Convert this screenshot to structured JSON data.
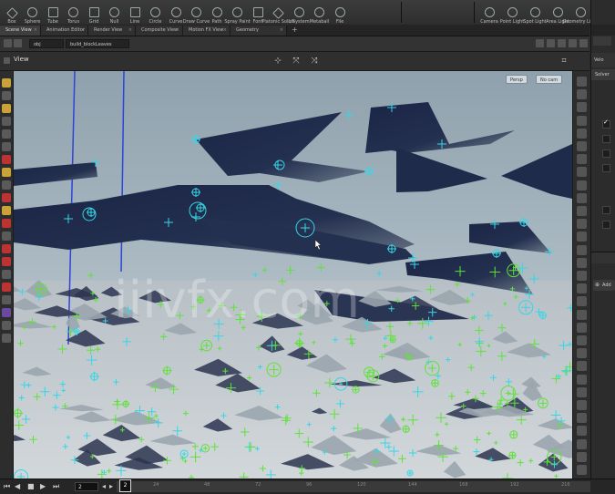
{
  "shelf_tools_left": [
    {
      "label": "Box",
      "icon": "box-icon"
    },
    {
      "label": "Sphere",
      "icon": "sphere-icon"
    },
    {
      "label": "Tube",
      "icon": "tube-icon"
    },
    {
      "label": "Torus",
      "icon": "torus-icon"
    },
    {
      "label": "Grid",
      "icon": "grid-icon"
    },
    {
      "label": "Null",
      "icon": "null-icon"
    },
    {
      "label": "Line",
      "icon": "line-icon"
    },
    {
      "label": "Circle",
      "icon": "circle-icon"
    },
    {
      "label": "Curve",
      "icon": "curve-icon"
    },
    {
      "label": "Draw Curve",
      "icon": "draw-curve-icon"
    },
    {
      "label": "Path",
      "icon": "path-icon"
    },
    {
      "label": "Spray Paint",
      "icon": "spray-paint-icon"
    },
    {
      "label": "Font",
      "icon": "font-icon"
    },
    {
      "label": "Platonic Solids",
      "icon": "platonic-icon"
    },
    {
      "label": "L-System",
      "icon": "lsystem-icon"
    },
    {
      "label": "Metaball",
      "icon": "metaball-icon"
    },
    {
      "label": "File",
      "icon": "file-icon"
    }
  ],
  "shelf_tools_right": [
    {
      "label": "Camera",
      "icon": "camera-icon"
    },
    {
      "label": "Point Light",
      "icon": "point-light-icon"
    },
    {
      "label": "Spot Light",
      "icon": "spot-light-icon"
    },
    {
      "label": "Area Light",
      "icon": "area-light-icon"
    },
    {
      "label": "Geometry Light",
      "icon": "geometry-light-icon"
    }
  ],
  "pane_tabs": [
    {
      "label": "Scene View",
      "active": true
    },
    {
      "label": "Animation Editor",
      "active": false
    },
    {
      "label": "Render View",
      "active": false
    },
    {
      "label": "Composite View",
      "active": false
    },
    {
      "label": "Motion FX View",
      "active": false
    },
    {
      "label": "Geometry Spreadsheet",
      "active": false
    }
  ],
  "path": {
    "root": "obj",
    "node": "build_blockLeaves"
  },
  "viewport": {
    "title": "View",
    "persp_label": "Persp",
    "cam_label": "No cam",
    "watermark": "iiivfx.com",
    "colors": {
      "shape": "#1f2b4a",
      "sky_top": "#8fa1ad",
      "ground": "#c7cdd1",
      "handle_cyan": "#37d6e6",
      "handle_green": "#5fe23a"
    }
  },
  "timeline": {
    "frame": "2",
    "current": "2",
    "ticks": [
      "24",
      "48",
      "72",
      "96",
      "120",
      "144",
      "168",
      "192",
      "216"
    ]
  },
  "right_panel": {
    "title": "Velo",
    "tab": "Solver",
    "add_label": "Add"
  }
}
